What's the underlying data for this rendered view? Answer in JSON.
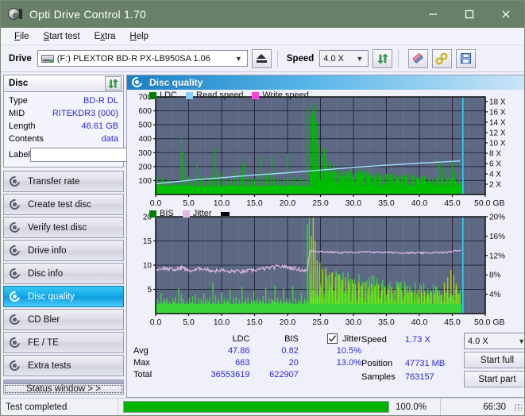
{
  "window": {
    "title": "Opti Drive Control 1.70",
    "icon": "optical-disc-icon",
    "minimize": "—",
    "maximize": "□",
    "close": "✕"
  },
  "menu": {
    "items": [
      {
        "label": "File",
        "accel": "F"
      },
      {
        "label": "Start test",
        "accel": "S"
      },
      {
        "label": "Extra",
        "accel": "x"
      },
      {
        "label": "Help",
        "accel": "H"
      }
    ]
  },
  "toolbar": {
    "drive_label": "Drive",
    "drive_value": "(F:)  PLEXTOR BD-R  PX-LB950SA 1.06",
    "eject_title": "Eject",
    "speed_label": "Speed",
    "speed_value": "4.0 X",
    "refresh_title": "Refresh",
    "erase_title": "Erase",
    "tools_title": "Tools",
    "save_title": "Save"
  },
  "disc_panel": {
    "title": "Disc",
    "refresh_icon": "refresh-arrows-icon",
    "rows": [
      {
        "label": "Type",
        "value": "BD-R DL"
      },
      {
        "label": "MID",
        "value": "RITEKDR3 (000)"
      },
      {
        "label": "Length",
        "value": "46.61 GB"
      },
      {
        "label": "Contents",
        "value": "data"
      }
    ],
    "label_field_label": "Label",
    "label_field_value": "",
    "label_field_placeholder": ""
  },
  "nav": {
    "items": [
      {
        "label": "Transfer rate",
        "active": false
      },
      {
        "label": "Create test disc",
        "active": false
      },
      {
        "label": "Verify test disc",
        "active": false
      },
      {
        "label": "Drive info",
        "active": false
      },
      {
        "label": "Disc info",
        "active": false
      },
      {
        "label": "Disc quality",
        "active": true
      },
      {
        "label": "CD Bler",
        "active": false
      },
      {
        "label": "FE / TE",
        "active": false
      },
      {
        "label": "Extra tests",
        "active": false
      }
    ],
    "status_window_label": "Status window > >"
  },
  "content": {
    "title": "Disc quality",
    "icon": "disc-quality-icon"
  },
  "stats": {
    "col_ldc": "LDC",
    "col_bis": "BIS",
    "col_jitter": "Jitter",
    "jitter_checked": true,
    "rows": [
      {
        "label": "Avg",
        "ldc": "47.86",
        "bis": "0.82",
        "jitter": "10.5%"
      },
      {
        "label": "Max",
        "ldc": "663",
        "bis": "20",
        "jitter": "13.0%"
      },
      {
        "label": "Total",
        "ldc": "36553619",
        "bis": "622907",
        "jitter": ""
      }
    ]
  },
  "readout": {
    "speed_label": "Speed",
    "speed_value": "1.73 X",
    "position_label": "Position",
    "position_value": "47731 MB",
    "samples_label": "Samples",
    "samples_value": "763157",
    "speed_select": "4.0 X",
    "start_full": "Start full",
    "start_part": "Start part"
  },
  "statusbar": {
    "text": "Test completed",
    "progress_percent": "100.0%",
    "progress_value": 100,
    "elapsed": "66:30"
  },
  "colors": {
    "titlebar": "#688068",
    "plot_bg": "#5d6885",
    "ldc_green": "#00a000",
    "bis_green": "#2fd22f",
    "read_speed": "#87cefa",
    "write_speed": "#ff44dd",
    "jitter_pink": "#e3b8e8",
    "marker_cyan": "#22d2f2",
    "accent_blue": "#2a2ad0",
    "progress_green": "#00b400"
  },
  "chart_data": [
    {
      "type": "line",
      "name": "disc-quality-errors",
      "title": "",
      "xlabel": "GB",
      "ylabel": "",
      "xlim": [
        0,
        50
      ],
      "xticks": [
        "0.0",
        "5.0",
        "10.0",
        "15.0",
        "20.0",
        "25.0",
        "30.0",
        "35.0",
        "40.0",
        "45.0",
        "50.0 GB"
      ],
      "ylim": [
        0,
        700
      ],
      "yticks": [
        "100",
        "200",
        "300",
        "400",
        "500",
        "600",
        "700"
      ],
      "y2label": "",
      "y2lim": [
        0,
        18
      ],
      "y2ticks": [
        "2 X",
        "4 X",
        "6 X",
        "8 X",
        "10 X",
        "12 X",
        "14 X",
        "16 X",
        "18 X"
      ],
      "grid": true,
      "legend": [
        {
          "label": "LDC",
          "color": "#008000"
        },
        {
          "label": "Read speed",
          "color": "#87cefa"
        },
        {
          "label": "Write speed",
          "color": "#ff44dd"
        }
      ],
      "series": [
        {
          "name": "LDC",
          "color": "#00b200",
          "kind": "impulse",
          "note": "dense green error spikes across whole disc; baseline ~40-60, heavy dense band after 23 GB",
          "baseline": 45,
          "x": [
            0.2,
            0.6,
            1.0,
            1.5,
            2.0,
            2.4,
            2.9,
            3.4,
            3.9,
            4.1,
            4.5,
            5.0,
            5.4,
            5.9,
            6.3,
            6.8,
            7.2,
            7.7,
            8.1,
            8.6,
            9.0,
            9.4,
            9.6,
            10.1,
            10.6,
            11.0,
            11.5,
            12.0,
            12.4,
            12.9,
            13.2,
            13.6,
            14.1,
            14.6,
            15.0,
            15.5,
            16.0,
            16.4,
            16.8,
            17.2,
            17.6,
            18.0,
            18.5,
            19.0,
            19.5,
            20.0,
            20.5,
            21.0,
            21.5,
            22.0,
            22.5,
            23.0,
            23.4,
            23.8,
            24.1,
            24.4,
            24.8,
            25.2,
            25.6,
            26.0,
            26.5,
            27.0,
            27.5,
            28.0,
            28.5,
            29.0,
            29.5,
            30.0,
            30.5,
            31.0,
            31.5,
            32.0,
            32.5,
            33.0,
            33.5,
            34.0,
            34.5,
            35.0,
            35.5,
            36.0,
            36.5,
            37.0,
            37.5,
            38.0,
            38.5,
            39.0,
            39.5,
            40.0,
            40.5,
            41.0,
            41.5,
            42.0,
            42.5,
            43.0,
            43.5,
            44.0,
            44.5,
            45.0,
            45.3,
            45.6,
            45.9
          ],
          "y": [
            140,
            95,
            120,
            70,
            110,
            85,
            95,
            75,
            405,
            300,
            215,
            130,
            90,
            105,
            230,
            120,
            145,
            95,
            110,
            135,
            335,
            175,
            110,
            150,
            120,
            95,
            105,
            160,
            110,
            130,
            215,
            265,
            120,
            115,
            110,
            140,
            275,
            115,
            145,
            165,
            270,
            120,
            105,
            95,
            110,
            290,
            105,
            130,
            95,
            115,
            100,
            625,
            560,
            600,
            660,
            520,
            350,
            290,
            330,
            260,
            230,
            210,
            180,
            165,
            190,
            150,
            170,
            145,
            160,
            135,
            175,
            150,
            140,
            130,
            160,
            120,
            135,
            145,
            125,
            115,
            140,
            120,
            130,
            110,
            125,
            105,
            115,
            100,
            120,
            95,
            110,
            105,
            130,
            260,
            215,
            175,
            120,
            230,
            160,
            95,
            70
          ]
        },
        {
          "name": "Read speed",
          "color": "#9fe0fb",
          "kind": "line",
          "note": "CAV read-speed ramp rising from ~2X at 0 GB to ~6X at 46 GB (plotted on right axis)",
          "x": [
            0,
            5,
            10,
            15,
            20,
            23,
            25,
            30,
            35,
            40,
            45,
            46.2
          ],
          "y": [
            2.0,
            2.6,
            3.1,
            3.6,
            4.0,
            4.3,
            4.5,
            5.0,
            5.4,
            5.8,
            6.1,
            6.2
          ]
        },
        {
          "name": "Write speed",
          "color": "#ff44dd",
          "kind": "line",
          "note": "not present in this plot",
          "x": [],
          "y": []
        },
        {
          "name": "end-marker",
          "color": "#22d2f2",
          "kind": "vline",
          "x": [
            46.6
          ],
          "y": []
        }
      ]
    },
    {
      "type": "line",
      "name": "disc-quality-bis-jitter",
      "title": "",
      "xlabel": "GB",
      "ylabel": "",
      "xlim": [
        0,
        50
      ],
      "xticks": [
        "0.0",
        "5.0",
        "10.0",
        "15.0",
        "20.0",
        "25.0",
        "30.0",
        "35.0",
        "40.0",
        "45.0",
        "50.0 GB"
      ],
      "ylim": [
        0,
        20
      ],
      "yticks": [
        "5",
        "10",
        "15",
        "20"
      ],
      "y2lim": [
        0,
        20
      ],
      "y2ticks": [
        "4%",
        "8%",
        "12%",
        "16%",
        "20%"
      ],
      "grid": true,
      "legend": [
        {
          "label": "BIS",
          "color": "#008000"
        },
        {
          "label": "Jitter",
          "color": "#e3b8e8"
        },
        {
          "label": "",
          "color": "#000000"
        }
      ],
      "series": [
        {
          "name": "BIS",
          "color": "#3ad63a",
          "kind": "impulse",
          "note": "green BIS spikes, baseline ~1-2, dense tall band 23-46 GB reaching ~20",
          "baseline": 1.6,
          "x": [
            0.3,
            0.8,
            1.2,
            1.7,
            2.1,
            2.6,
            3.0,
            3.5,
            3.9,
            4.2,
            4.7,
            5.1,
            5.6,
            6.0,
            6.5,
            6.9,
            7.3,
            7.8,
            8.2,
            8.7,
            9.1,
            9.5,
            10.0,
            10.4,
            10.9,
            11.3,
            11.8,
            12.2,
            12.7,
            13.1,
            13.6,
            14.0,
            14.5,
            14.9,
            15.4,
            15.8,
            16.3,
            16.7,
            17.2,
            17.6,
            18.1,
            18.5,
            19.0,
            19.4,
            19.9,
            20.3,
            20.8,
            21.2,
            21.7,
            22.1,
            22.6,
            23.0,
            23.3,
            23.6,
            23.9,
            24.2,
            24.5,
            24.9,
            25.3,
            25.8,
            26.3,
            26.8,
            27.3,
            27.8,
            28.3,
            28.8,
            29.3,
            29.8,
            30.3,
            30.8,
            31.3,
            31.8,
            32.3,
            32.8,
            33.3,
            33.8,
            34.3,
            34.8,
            35.3,
            35.8,
            36.3,
            36.8,
            37.3,
            37.8,
            38.3,
            38.8,
            39.3,
            39.8,
            40.3,
            40.8,
            41.3,
            41.8,
            42.3,
            42.8,
            43.3,
            43.8,
            44.3,
            44.8,
            45.2,
            45.6,
            46.0
          ],
          "y": [
            3.0,
            4.2,
            3.0,
            3.2,
            2.6,
            3.0,
            3.4,
            5.2,
            4.0,
            3.0,
            2.6,
            3.2,
            3.6,
            4.0,
            3.2,
            3.0,
            4.2,
            3.0,
            3.4,
            6.4,
            3.8,
            3.0,
            4.4,
            3.2,
            3.0,
            5.0,
            3.2,
            3.4,
            3.0,
            5.6,
            3.2,
            3.4,
            3.0,
            4.8,
            3.2,
            3.0,
            3.6,
            5.4,
            3.2,
            3.0,
            5.8,
            3.4,
            3.0,
            5.2,
            3.2,
            3.0,
            5.6,
            3.2,
            3.0,
            4.4,
            3.2,
            18.5,
            20.0,
            16.0,
            20.0,
            15.0,
            11.0,
            10.5,
            9.0,
            9.5,
            8.0,
            8.5,
            7.5,
            8.0,
            7.0,
            7.5,
            6.5,
            7.0,
            6.0,
            6.5,
            6.0,
            6.5,
            5.5,
            6.0,
            5.5,
            6.0,
            5.0,
            5.5,
            5.0,
            5.5,
            5.0,
            5.5,
            4.5,
            5.0,
            4.5,
            5.0,
            4.5,
            5.0,
            4.5,
            4.5,
            4.0,
            4.5,
            4.0,
            4.5,
            4.0,
            6.5,
            7.5,
            9.0,
            8.0,
            6.0,
            4.0
          ]
        },
        {
          "name": "Jitter",
          "color": "#e3b8e8",
          "kind": "line",
          "note": "jitter trace ~8.5-10.5% across 0-23 GB, steps up to ~13% after 23 GB",
          "x": [
            0,
            1,
            2,
            3,
            4,
            5,
            6,
            7,
            8,
            9,
            10,
            11,
            12,
            13,
            14,
            15,
            16,
            17,
            18,
            19,
            20,
            21,
            22,
            23,
            23.4,
            25,
            28,
            32,
            36,
            40,
            44,
            46.2
          ],
          "y": [
            9.0,
            9.4,
            9.2,
            9.0,
            9.6,
            8.8,
            9.0,
            9.4,
            9.0,
            8.8,
            9.0,
            8.6,
            8.8,
            8.6,
            8.8,
            9.0,
            9.2,
            9.4,
            9.6,
            9.8,
            9.6,
            9.4,
            9.0,
            8.8,
            13.0,
            12.8,
            12.6,
            12.7,
            12.6,
            12.5,
            12.6,
            13.1
          ]
        },
        {
          "name": "end-marker",
          "color": "#22d2f2",
          "kind": "vline",
          "x": [
            46.6
          ],
          "y": []
        }
      ]
    }
  ]
}
